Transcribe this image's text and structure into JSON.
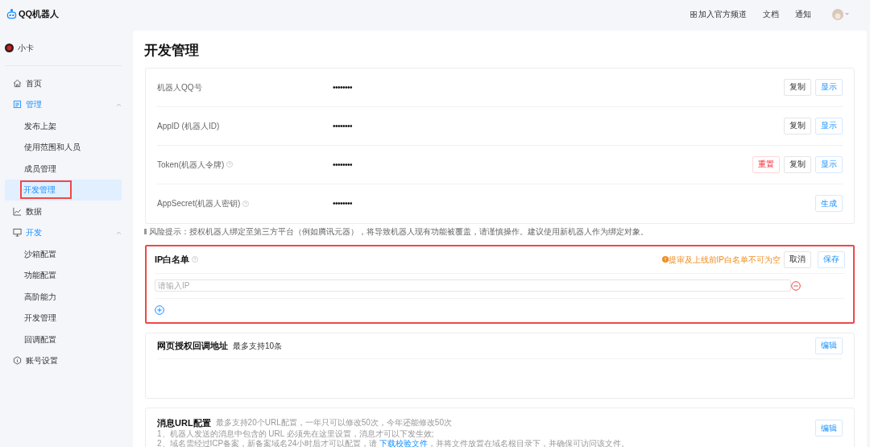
{
  "header": {
    "logo_text": "QQ机器人",
    "links": [
      {
        "label": "加入官方频道"
      },
      {
        "label": "文档"
      },
      {
        "label": "通知"
      }
    ]
  },
  "sidebar": {
    "bot_name": "小卡",
    "items": [
      {
        "label": "首页",
        "selected": false,
        "highlighted": false
      },
      {
        "label": "管理",
        "selected": false,
        "highlighted": false,
        "expanded": true,
        "children": [
          {
            "label": "发布上架",
            "selected": false,
            "highlighted": false
          },
          {
            "label": "使用范围和人员",
            "selected": false,
            "highlighted": false
          },
          {
            "label": "成员管理",
            "selected": false,
            "highlighted": false
          },
          {
            "label": "开发管理",
            "selected": true,
            "highlighted": true
          }
        ]
      },
      {
        "label": "数据",
        "selected": false,
        "highlighted": false
      },
      {
        "label": "开发",
        "selected": false,
        "highlighted": false,
        "expanded": true,
        "children": [
          {
            "label": "沙箱配置",
            "selected": false,
            "highlighted": false
          },
          {
            "label": "功能配置",
            "selected": false,
            "highlighted": false
          },
          {
            "label": "高阶能力",
            "selected": false,
            "highlighted": false
          },
          {
            "label": "开发管理",
            "selected": false,
            "highlighted": false
          },
          {
            "label": "回调配置",
            "selected": false,
            "highlighted": false
          }
        ]
      },
      {
        "label": "账号设置",
        "selected": false,
        "highlighted": false
      }
    ]
  },
  "page_title": "开发管理",
  "credentials": [
    {
      "label": "机器人QQ号",
      "help": false,
      "value": "••••••••",
      "buttons": [
        {
          "label": "复制",
          "kind": "default"
        },
        {
          "label": "显示",
          "kind": "primary"
        }
      ]
    },
    {
      "label": "AppID (机器人ID)",
      "help": false,
      "value": "••••••••",
      "buttons": [
        {
          "label": "复制",
          "kind": "default"
        },
        {
          "label": "显示",
          "kind": "primary"
        }
      ]
    },
    {
      "label": "Token(机器人令牌)",
      "help": true,
      "value": "••••••••",
      "buttons": [
        {
          "label": "重置",
          "kind": "danger"
        },
        {
          "label": "复制",
          "kind": "default"
        },
        {
          "label": "显示",
          "kind": "primary"
        }
      ]
    },
    {
      "label": "AppSecret(机器人密钥)",
      "help": true,
      "value": "••••••••",
      "buttons": [
        {
          "label": "生成",
          "kind": "primary"
        }
      ]
    }
  ],
  "risk_tip": "风险提示：授权机器人绑定至第三方平台（例如腾讯元器），将导致机器人现有功能被覆盖，请谨慎操作。建议使用新机器人作为绑定对象。",
  "ip_whitelist": {
    "title": "IP白名单",
    "highlighted": true,
    "warning": "提审及上线前IP白名单不可为空",
    "buttons": [
      {
        "label": "取消",
        "kind": "default"
      },
      {
        "label": "保存",
        "kind": "primary"
      }
    ],
    "inputs": [
      {
        "placeholder": "请输入IP"
      }
    ]
  },
  "web_auth": {
    "title": "网页授权回调地址",
    "note": "最多支持10条",
    "button": "编辑"
  },
  "message_url": {
    "title": "消息URL配置",
    "note": "最多支持20个URL配置，一年只可以修改50次，今年还能修改50次",
    "lines": [
      {
        "text": "1、机器人发送的消息中包含的 URL 必须先在这里设置，消息才可以下发生效;"
      },
      {
        "text": "2、域名需经过ICP备案，新备案域名24小时后才可以配置，请 ",
        "link": "下载校验文件",
        "text_after": "，并将文件放置在域名根目录下，并确保可访问该文件。"
      }
    ],
    "button": "编辑"
  }
}
